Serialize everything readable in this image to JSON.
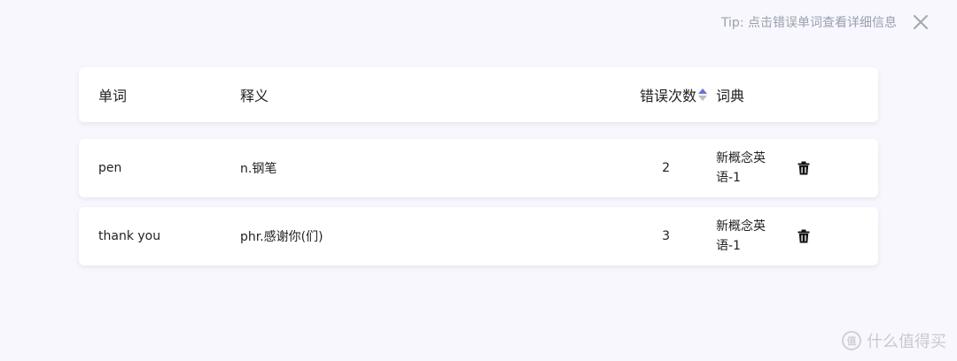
{
  "tip": "Tip: 点击错误单词查看详细信息",
  "header": {
    "word": "单词",
    "definition": "释义",
    "error_count": "错误次数",
    "dictionary": "词典"
  },
  "rows": [
    {
      "word": "pen",
      "definition": "n.钢笔",
      "count": "2",
      "dictionary": "新概念英语-1"
    },
    {
      "word": "thank you",
      "definition": "phr.感谢你(们)",
      "count": "3",
      "dictionary": "新概念英语-1"
    }
  ],
  "icons": {
    "close": "close-icon",
    "sort": "sort-icon",
    "delete": "trash-icon"
  },
  "colors": {
    "background": "#f7f7fd",
    "sort_active": "#6a6fd8",
    "sort_inactive": "#b9bcc6",
    "tip_text": "#9aa0ad"
  },
  "watermark": {
    "logo_text": "值",
    "text": "什么值得买"
  }
}
